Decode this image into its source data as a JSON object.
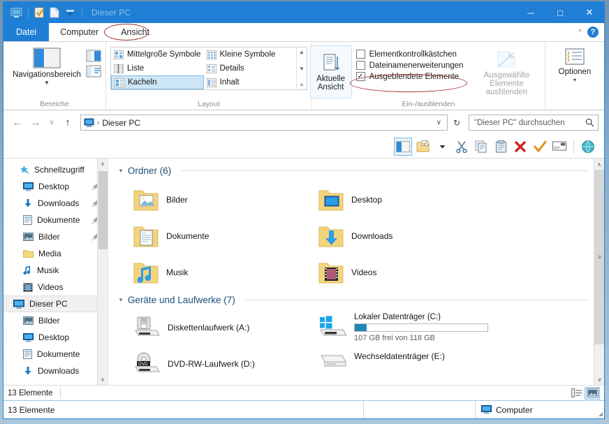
{
  "window": {
    "title": "Dieser PC",
    "controls": {
      "minimize": "─",
      "maximize": "□",
      "close": "✕"
    },
    "quick_access": [
      "computer-icon",
      "properties-icon",
      "new-folder-icon",
      "dropdown-caret"
    ]
  },
  "tabs": {
    "file": "Datei",
    "items": [
      {
        "label": "Computer",
        "active": false
      },
      {
        "label": "Ansicht",
        "active": true,
        "annotated": true
      }
    ],
    "collapse_icon": "chevron-up-icon",
    "help_icon": "?"
  },
  "ribbon": {
    "groups": [
      {
        "name": "Bereiche",
        "label": "Bereiche",
        "big_button": {
          "label": "Navigationsbereich",
          "caret": "▼"
        },
        "mini_buttons": [
          "preview-pane-icon",
          "details-pane-icon"
        ]
      },
      {
        "name": "Layout",
        "label": "Layout",
        "gallery": [
          {
            "label": "Mittelgroße Symbole",
            "selected": false
          },
          {
            "label": "Liste",
            "selected": false
          },
          {
            "label": "Kacheln",
            "selected": true
          },
          {
            "label": "Kleine Symbole",
            "selected": false
          },
          {
            "label": "Details",
            "selected": false
          },
          {
            "label": "Inhalt",
            "selected": false
          }
        ],
        "scroll": {
          "up": "▲",
          "down": "▼",
          "more": "≡"
        }
      },
      {
        "name": "Ein-/ausblenden",
        "label": "Ein-/ausblenden",
        "current_view": {
          "line1": "Aktuelle",
          "line2": "Ansicht",
          "caret": "▾"
        },
        "checkboxes": [
          {
            "label": "Elementkontrollkästchen",
            "checked": false
          },
          {
            "label": "Dateinamenerweiterungen",
            "checked": false
          },
          {
            "label": "Ausgeblendete Elemente",
            "checked": true,
            "annotated": true
          }
        ],
        "hide_selected": {
          "line1": "Ausgewählte",
          "line2": "Elemente ausblenden",
          "disabled": true
        }
      },
      {
        "name": "Optionen",
        "label": "",
        "options_button": {
          "label": "Optionen",
          "caret": "▾"
        }
      }
    ]
  },
  "address_bar": {
    "back": "←",
    "forward": "→",
    "history": "∨",
    "up": "↑",
    "crumb_icon": "computer-icon",
    "separator": "›",
    "path": "Dieser PC",
    "dropdown": "∨",
    "refresh": "↻",
    "search_placeholder": "\"Dieser PC\" durchsuchen",
    "search_value": "",
    "search_icon": "search-icon"
  },
  "custom_toolbar": {
    "items": [
      {
        "name": "navigation-pane-toggle-icon",
        "boxed": true
      },
      {
        "name": "new-folder-icon",
        "boxed": false
      },
      {
        "name": "dropdown-caret-icon",
        "boxed": false
      },
      {
        "name": "cut-scissors-icon",
        "boxed": false
      },
      {
        "name": "copy-icon",
        "boxed": false
      },
      {
        "name": "paste-clipboard-icon",
        "boxed": false
      },
      {
        "name": "delete-red-x-icon",
        "boxed": false
      },
      {
        "name": "confirm-orange-check-icon",
        "boxed": false
      },
      {
        "name": "rename-icon",
        "boxed": false
      },
      {
        "name": "internet-globe-icon",
        "boxed": false
      }
    ]
  },
  "sidebar": {
    "items": [
      {
        "label": "Schnellzugriff",
        "icon": "star-pin-icon",
        "indent": false,
        "pinned": false,
        "selected": false
      },
      {
        "label": "Desktop",
        "icon": "desktop-monitor-icon",
        "indent": true,
        "pinned": true,
        "selected": false
      },
      {
        "label": "Downloads",
        "icon": "download-arrow-icon",
        "indent": true,
        "pinned": true,
        "selected": false
      },
      {
        "label": "Dokumente",
        "icon": "document-icon",
        "indent": true,
        "pinned": true,
        "selected": false
      },
      {
        "label": "Bilder",
        "icon": "picture-icon",
        "indent": true,
        "pinned": true,
        "selected": false
      },
      {
        "label": "Media",
        "icon": "folder-icon",
        "indent": true,
        "pinned": false,
        "selected": false
      },
      {
        "label": "Musik",
        "icon": "music-note-icon",
        "indent": true,
        "pinned": false,
        "selected": false
      },
      {
        "label": "Videos",
        "icon": "video-film-icon",
        "indent": true,
        "pinned": false,
        "selected": false
      },
      {
        "label": "Dieser PC",
        "icon": "computer-icon",
        "indent": false,
        "pinned": false,
        "selected": true
      },
      {
        "label": "Bilder",
        "icon": "picture-icon",
        "indent": true,
        "pinned": false,
        "selected": false
      },
      {
        "label": "Desktop",
        "icon": "desktop-monitor-icon",
        "indent": true,
        "pinned": false,
        "selected": false
      },
      {
        "label": "Dokumente",
        "icon": "document-icon",
        "indent": true,
        "pinned": false,
        "selected": false
      },
      {
        "label": "Downloads",
        "icon": "download-arrow-icon",
        "indent": true,
        "pinned": false,
        "selected": false
      }
    ],
    "pin_glyph": "📌",
    "scroll": {
      "up": "∧",
      "down": "∨"
    }
  },
  "content": {
    "sections": [
      {
        "title": "Ordner (6)",
        "collapse": "◢",
        "items": [
          {
            "label": "Bilder",
            "icon": "folder-pictures-icon"
          },
          {
            "label": "Desktop",
            "icon": "folder-desktop-icon"
          },
          {
            "label": "Dokumente",
            "icon": "folder-documents-icon"
          },
          {
            "label": "Downloads",
            "icon": "folder-downloads-icon"
          },
          {
            "label": "Musik",
            "icon": "folder-music-icon"
          },
          {
            "label": "Videos",
            "icon": "folder-videos-icon"
          }
        ]
      },
      {
        "title": "Geräte und Laufwerke (7)",
        "collapse": "◢",
        "items": [
          {
            "label": "Diskettenlaufwerk (A:)",
            "icon": "floppy-drive-icon"
          },
          {
            "label": "Lokaler Datenträger (C:)",
            "icon": "windows-drive-icon",
            "usage_text": "107 GB frei von 118 GB",
            "used_percent": 9,
            "bar_color": "#1f87b5"
          },
          {
            "label": "DVD-RW-Laufwerk (D:)",
            "icon": "dvd-drive-icon"
          },
          {
            "label": "Wechseldatenträger (E:)",
            "icon": "removable-drive-icon"
          }
        ]
      }
    ],
    "scroll": {
      "up": "∧",
      "down": "∨",
      "grip": "≡"
    }
  },
  "inner_status": {
    "items_count": "13 Elemente",
    "view_buttons": [
      {
        "name": "details-view-button",
        "selected": false
      },
      {
        "name": "thumbnail-view-button",
        "selected": true
      }
    ]
  },
  "outer_status": {
    "items_count": "13 Elemente",
    "computer_label": "Computer",
    "computer_icon": "computer-icon"
  },
  "colors": {
    "titlebar_blue": "#1f7fd4",
    "accent_blue": "#1f87b5",
    "annotation_red": "#a03030",
    "section_header": "#1b4f7a",
    "selection": "#cde6f7"
  }
}
